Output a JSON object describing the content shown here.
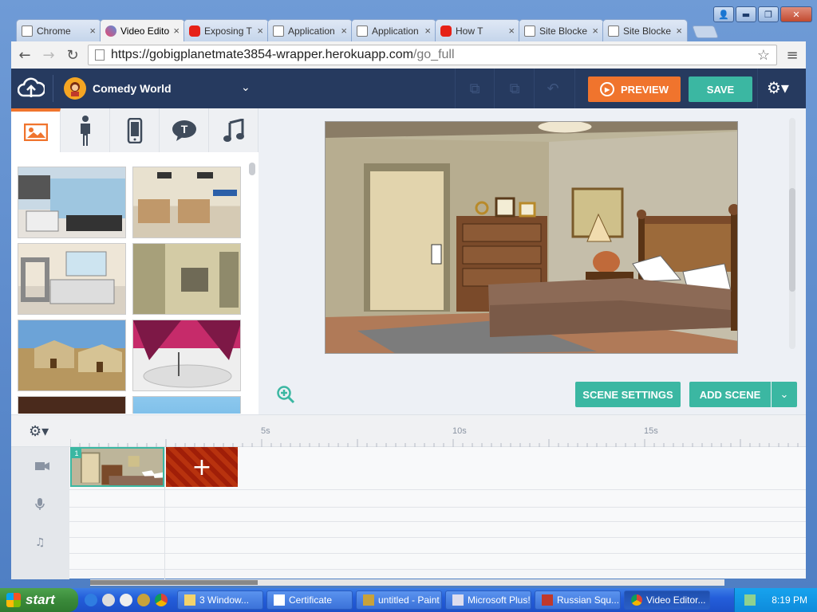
{
  "window": {
    "controls": [
      "👤",
      "▬",
      "❐",
      "✕"
    ]
  },
  "browser": {
    "tabs": [
      {
        "label": "Chrome",
        "icon": "doc",
        "close": "×"
      },
      {
        "label": "Video Edito",
        "icon": "ve",
        "close": "×",
        "active": true
      },
      {
        "label": "Exposing T",
        "icon": "yt",
        "close": "×"
      },
      {
        "label": "Application",
        "icon": "doc",
        "close": "×"
      },
      {
        "label": "Application",
        "icon": "doc",
        "close": "×"
      },
      {
        "label": "How T",
        "icon": "yt",
        "close": "×"
      },
      {
        "label": "Site Blocke",
        "icon": "doc",
        "close": "×"
      },
      {
        "label": "Site Blocke",
        "icon": "doc",
        "close": "×"
      }
    ],
    "nav": {
      "back": "←",
      "forward": "→",
      "reload": "↻",
      "menu": "≡"
    },
    "url_host": "https://gobigplanetmate3854-wrapper.herokuapp.com",
    "url_path": "/go_full",
    "star": "☆"
  },
  "app": {
    "theme_name": "Comedy World",
    "theme_chevron": "⌄",
    "preview_label": "PREVIEW",
    "save_label": "SAVE",
    "header_icons": [
      "⧉",
      "⧉",
      "↶"
    ],
    "settings": "⚙▾",
    "library_tabs": [
      {
        "name": "backgrounds",
        "glyph": "🖼"
      },
      {
        "name": "characters",
        "glyph": "🚶"
      },
      {
        "name": "props",
        "glyph": "▯"
      },
      {
        "name": "text",
        "glyph": "💬"
      },
      {
        "name": "sound",
        "glyph": "♫"
      }
    ],
    "scene_settings_label": "SCENE SETTINGS",
    "add_scene_label": "ADD SCENE",
    "add_scene_dd": "⌄",
    "zoom": "⊕"
  },
  "timeline": {
    "gear": "⚙▾",
    "ticks": [
      "5s",
      "10s",
      "15s"
    ],
    "tracks": [
      {
        "name": "video",
        "glyph": "■"
      },
      {
        "name": "voice",
        "glyph": "🎤"
      },
      {
        "name": "music",
        "glyph": "♫"
      }
    ],
    "scene_number": "1",
    "add_glyph": "+"
  },
  "taskbar": {
    "start_label": "start",
    "tasks": [
      {
        "label": "3 Window...",
        "icon": "folder"
      },
      {
        "label": "Certificate",
        "icon": "window"
      },
      {
        "label": "untitled - Paint",
        "icon": "paint"
      },
      {
        "label": "Microsoft Plus!",
        "icon": "plus"
      },
      {
        "label": "Russian Squ...",
        "icon": "cube"
      },
      {
        "label": "Video Editor...",
        "icon": "chrome",
        "active": true
      }
    ],
    "time": "8:19 PM"
  },
  "colors": {
    "accent_orange": "#f0742d",
    "accent_teal": "#3bb7a2",
    "header_navy": "#263a5f"
  }
}
